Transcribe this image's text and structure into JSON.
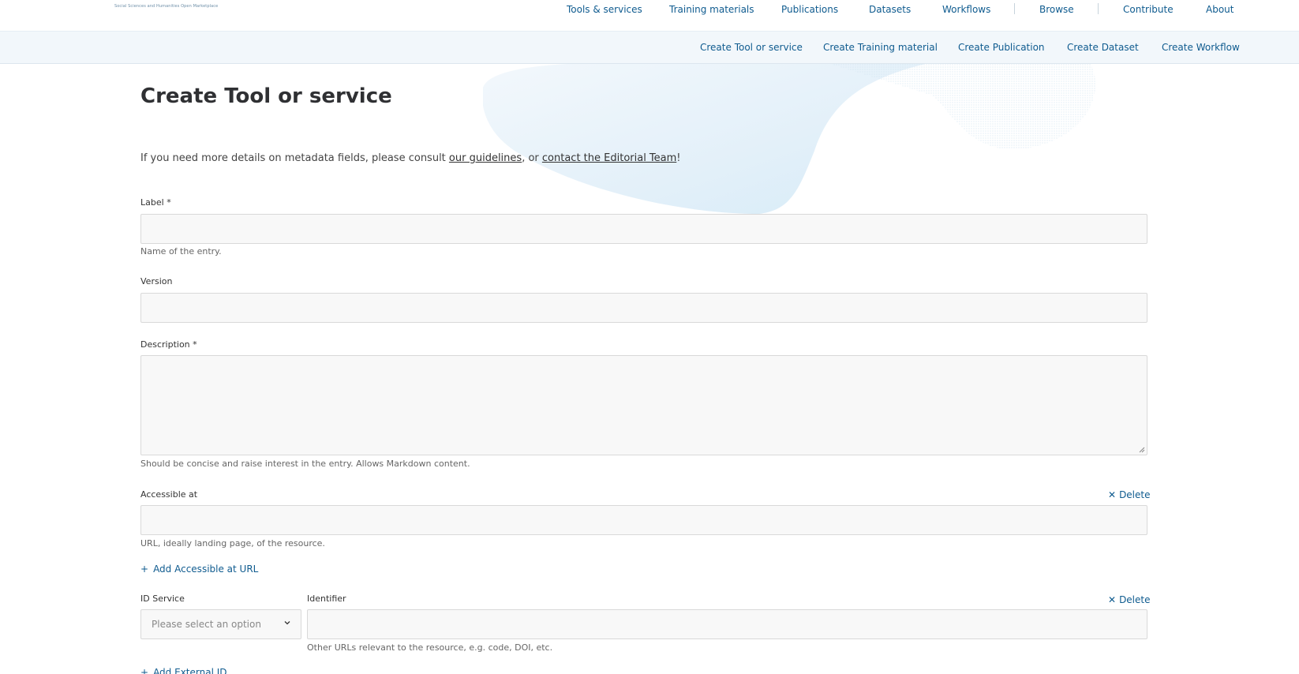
{
  "header": {
    "tagline": "Social Sciences and Humanities Open Marketplace",
    "nav": [
      "Tools & services",
      "Training materials",
      "Publications",
      "Datasets",
      "Workflows",
      "Browse",
      "Contribute",
      "About"
    ]
  },
  "subnav": [
    "Create Tool or service",
    "Create Training material",
    "Create Publication",
    "Create Dataset",
    "Create Workflow"
  ],
  "page": {
    "title": "Create Tool or service",
    "intro_before": "If you need more details on metadata fields, please consult ",
    "intro_link1": "our guidelines",
    "intro_middle": ", or ",
    "intro_link2": "contact the Editorial Team",
    "intro_after": "!"
  },
  "form": {
    "label": {
      "label": "Label",
      "required": "*",
      "hint": "Name of the entry."
    },
    "version": {
      "label": "Version"
    },
    "description": {
      "label": "Description",
      "required": "*",
      "hint": "Should be concise and raise interest in the entry. Allows Markdown content."
    },
    "accessible_at": {
      "label": "Accessible at",
      "delete": "Delete",
      "hint": "URL, ideally landing page, of the resource.",
      "add": "Add Accessible at URL"
    },
    "external_id": {
      "service_label": "ID Service",
      "service_placeholder": "Please select an option",
      "identifier_label": "Identifier",
      "delete": "Delete",
      "hint": "Other URLs relevant to the resource, e.g. code, DOI, etc.",
      "add": "Add External ID"
    }
  },
  "colors": {
    "link": "#0f5b8f",
    "subbar_bg": "#f2f7fb",
    "input_bg": "#f8f8f8"
  }
}
